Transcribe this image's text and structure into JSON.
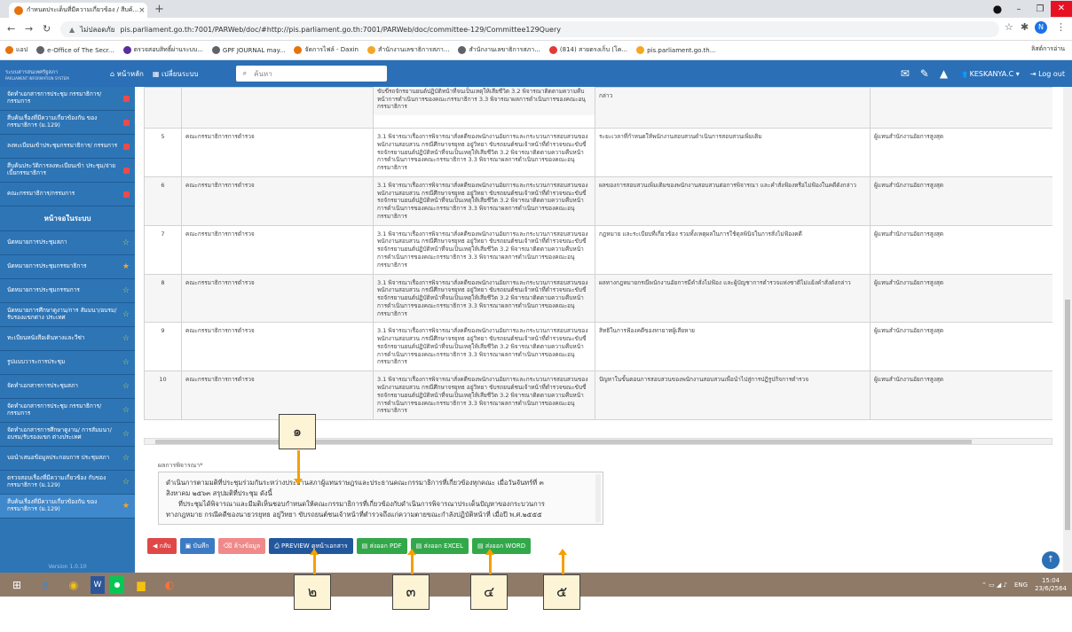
{
  "browser": {
    "tab_title": "กำหนดประเด็นที่มีความเกี่ยวข้อง / สืบค้...",
    "new_tab": "+",
    "url_warning": "ไม่ปลอดภัย",
    "url": "pis.parliament.go.th:7001/PARWeb/doc/#http://pis.parliament.go.th:7001/PARWeb/doc/committee-129/Committee129Query",
    "profile_initial": "N",
    "reading_list": "ลิสต์การอ่าน"
  },
  "bookmarks": [
    {
      "label": "แอป",
      "color": "#e8710a"
    },
    {
      "label": "e-Office of The Secr...",
      "color": "#5f6368"
    },
    {
      "label": "ตรวจสอบสิทธิ์ผ่านระบบ...",
      "color": "#5b2c9e"
    },
    {
      "label": "GPF JOURNAL may...",
      "color": "#5f6368"
    },
    {
      "label": "จัดการไฟล์ - Daxin",
      "color": "#e8710a"
    },
    {
      "label": "สำนักงานเลขาธิการสภา...",
      "color": "#f5a623"
    },
    {
      "label": "สำนักงานเลขาธิการสภา...",
      "color": "#5f6368"
    },
    {
      "label": "(814) สายตรงเก็บ (โค...",
      "color": "#e53935"
    },
    {
      "label": "pis.parliament.go.th...",
      "color": "#f5a623"
    }
  ],
  "appbar": {
    "logo_line1": "ระบบสารสนเทศรัฐสภา",
    "logo_line2": "PARLIAMENT INFORMATION SYSTEM",
    "home": "หน้าหลัก",
    "change_system": "เปลี่ยนระบบ",
    "search_placeholder": "ค้นหา",
    "user": "KESKANYA.C",
    "logout": "Log out"
  },
  "sidebar": {
    "items_top": [
      {
        "label": "จัดทำเอกสารการประชุม กรรมาธิการ/กรรมการ"
      },
      {
        "label": "สืบค้นเรื่องที่มีความเกี่ยวข้องกัน ของกรรมาธิการ (ม.129)"
      },
      {
        "label": "ลงทะเบียนเข้าประชุมกรรมาธิการ/ กรรมการ"
      },
      {
        "label": "สืบค้นประวัติการลงทะเบียนเข้า ประชุม/จ่ายเบี้ยกรรมาธิการ"
      },
      {
        "label": "คณะกรรมาธิการ/กรรมการ"
      }
    ],
    "section": "หน้าจอในระบบ",
    "items_screens": [
      {
        "label": "นัดหมายการประชุมสภา",
        "gold": false
      },
      {
        "label": "นัดหมายการประชุมกรรมาธิการ",
        "gold": true
      },
      {
        "label": "นัดหมายการประชุมกรรมการ",
        "gold": false
      },
      {
        "label": "นัดหมายการศึกษาดูงาน/การ สัมมนา/อบรม/รับรองแขกต่าง ประเทศ",
        "gold": false
      },
      {
        "label": "ทะเบียนหนังสือเดินทางและวีซ่า",
        "gold": false
      },
      {
        "label": "รูปแบบวาระการประชุม",
        "gold": false
      },
      {
        "label": "จัดทำเอกสารการประชุมสภา",
        "gold": false
      },
      {
        "label": "จัดทำเอกสารการประชุม กรรมาธิการ/กรรมการ",
        "gold": false
      },
      {
        "label": "จัดทำเอกสารการศึกษาดูงาน/ การสัมมนา/อบรม/รับรองแขก ต่างประเทศ",
        "gold": false
      },
      {
        "label": "บอนำเสนอข้อมูลประกอบการ ประชุมสภา",
        "gold": false
      },
      {
        "label": "ตรวจสอบเรื่องที่มีความเกี่ยวข้อง กับของกรรมาธิการ (ม.129)",
        "gold": false
      },
      {
        "label": "สืบค้นเรื่องที่มีความเกี่ยวข้องกัน ของกรรมาธิการ (ม.129)",
        "gold": true
      }
    ],
    "version": "Version 1.0.10"
  },
  "table": {
    "partial_top": {
      "col3": "ของพนักงานสอบสวน กรณีศึกษาจรยุทธ อยู่วิทยา ขับรถยนต์ชนเจ้าหน้าที่ตำรวจ ขณะขับขี่รถจักรยานยนต์ปฏิบัติหน้าที่จนเป็นเหตุให้เสียชีวิต 3.2 พิจารณาติดตามความคืบหน้าการดำเนินการของคณะกรรมาธิการ 3.3 พิจารณาผลการดำเนินการของคณะอนุกรรมาธิการ",
      "col4": "กล่าว"
    },
    "rows": [
      {
        "no": "5",
        "committee": "คณะกรรมาธิการการตำรวจ",
        "agenda": "3.1 พิจารณาเรื่องการพิจารณาสั่งคดีของพนักงานอัยการและกระบวนการสอบสวนของพนักงานสอบสวน กรณีศึกษาจรยุทธ อยู่วิทยา ขับรถยนต์ชนเจ้าหน้าที่ตำรวจขณะขับขี่รถจักรยานยนต์ปฏิบัติหน้าที่จนเป็นเหตุให้เสียชีวิต 3.2 พิจารณาติดตามความคืบหน้าการดำเนินการของคณะกรรมาธิการ 3.3 พิจารณาผลการดำเนินการของคณะอนุกรรมาธิการ",
        "issue": "ระยะเวลาที่กำหนดให้พนักงานสอบสวนดำเนินการสอบสวนเพิ่มเติม",
        "invitee": "ผู้แทนสำนักงานอัยการสูงสุด"
      },
      {
        "no": "6",
        "committee": "คณะกรรมาธิการการตำรวจ",
        "agenda": "3.1 พิจารณาเรื่องการพิจารณาสั่งคดีของพนักงานอัยการและกระบวนการสอบสวนของพนักงานสอบสวน กรณีศึกษาจรยุทธ อยู่วิทยา ขับรถยนต์ชนเจ้าหน้าที่ตำรวจขณะขับขี่รถจักรยานยนต์ปฏิบัติหน้าที่จนเป็นเหตุให้เสียชีวิต 3.2 พิจารณาติดตามความคืบหน้าการดำเนินการของคณะกรรมาธิการ 3.3 พิจารณาผลการดำเนินการของคณะอนุกรรมาธิการ",
        "issue": "ผลของการสอบสวนเพิ่มเติมของพนักงานสอบสวนต่อการพิจารณา และคำสั่งฟ้องหรือไม่ฟ้องในคดีดังกล่าว",
        "invitee": "ผู้แทนสำนักงานอัยการสูงสุด"
      },
      {
        "no": "7",
        "committee": "คณะกรรมาธิการการตำรวจ",
        "agenda": "3.1 พิจารณาเรื่องการพิจารณาสั่งคดีของพนักงานอัยการและกระบวนการสอบสวนของพนักงานสอบสวน กรณีศึกษาจรยุทธ อยู่วิทยา ขับรถยนต์ชนเจ้าหน้าที่ตำรวจขณะขับขี่รถจักรยานยนต์ปฏิบัติหน้าที่จนเป็นเหตุให้เสียชีวิต 3.2 พิจารณาติดตามความคืบหน้าการดำเนินการของคณะกรรมาธิการ 3.3 พิจารณาผลการดำเนินการของคณะอนุกรรมาธิการ",
        "issue": "กฎหมาย และระเบียบที่เกี่ยวข้อง รวมทั้งเหตุผลในการใช้ดุลพินิจในการสั่งไม่ฟ้องคดี",
        "invitee": "ผู้แทนสำนักงานอัยการสูงสุด"
      },
      {
        "no": "8",
        "committee": "คณะกรรมาธิการการตำรวจ",
        "agenda": "3.1 พิจารณาเรื่องการพิจารณาสั่งคดีของพนักงานอัยการและกระบวนการสอบสวนของพนักงานสอบสวน กรณีศึกษาจรยุทธ อยู่วิทยา ขับรถยนต์ชนเจ้าหน้าที่ตำรวจขณะขับขี่รถจักรยานยนต์ปฏิบัติหน้าที่จนเป็นเหตุให้เสียชีวิต 3.2 พิจารณาติดตามความคืบหน้าการดำเนินการของคณะกรรมาธิการ 3.3 พิจารณาผลการดำเนินการของคณะอนุกรรมาธิการ",
        "issue": "ผลทางกฎหมายกรณีพนักงานอัยการมีคำสั่งไม่ฟ้อง และผู้บัญชาการตำรวจแห่งชาติไม่แย้งคำสั่งดังกล่าว",
        "invitee": "ผู้แทนสำนักงานอัยการสูงสุด"
      },
      {
        "no": "9",
        "committee": "คณะกรรมาธิการการตำรวจ",
        "agenda": "3.1 พิจารณาเรื่องการพิจารณาสั่งคดีของพนักงานอัยการและกระบวนการสอบสวนของพนักงานสอบสวน กรณีศึกษาจรยุทธ อยู่วิทยา ขับรถยนต์ชนเจ้าหน้าที่ตำรวจขณะขับขี่รถจักรยานยนต์ปฏิบัติหน้าที่จนเป็นเหตุให้เสียชีวิต 3.2 พิจารณาติดตามความคืบหน้าการดำเนินการของคณะกรรมาธิการ 3.3 พิจารณาผลการดำเนินการของคณะอนุกรรมาธิการ",
        "issue": "สิทธิในการฟ้องคดีของทายาทผู้เสียหาย",
        "invitee": "ผู้แทนสำนักงานอัยการสูงสุด"
      },
      {
        "no": "10",
        "committee": "คณะกรรมาธิการการตำรวจ",
        "agenda": "3.1 พิจารณาเรื่องการพิจารณาสั่งคดีของพนักงานอัยการและกระบวนการสอบสวนของพนักงานสอบสวน กรณีศึกษาจรยุทธ อยู่วิทยา ขับรถยนต์ชนเจ้าหน้าที่ตำรวจขณะขับขี่รถจักรยานยนต์ปฏิบัติหน้าที่จนเป็นเหตุให้เสียชีวิต 3.2 พิจารณาติดตามความคืบหน้าการดำเนินการของคณะกรรมาธิการ 3.3 พิจารณาผลการดำเนินการของคณะอนุกรรมาธิการ",
        "issue": "ปัญหาในขั้นตอนการสอบสวนของพนักงานสอบสวนเพื่อนำไปสู่การปฏิรูปกิจการตำรวจ",
        "invitee": "ผู้แทนสำนักงานอัยการสูงสุด"
      }
    ]
  },
  "result": {
    "label": "ผลการพิจารณา*",
    "line1": "ดำเนินการตามมติที่ประชุมร่วมกันระหว่างประธานสภาผู้แทนราษฎรและประธานคณะกรรมาธิการที่เกี่ยวข้องทุกคณะ เมื่อวันจันทร์ที่ ๓",
    "line2": "สิงหาคม ๒๕๖๓ สรุปมติที่ประชุม ดังนี้",
    "line3": "ที่ประชุมได้พิจารณาและมีมติเห็นชอบกำหนดให้คณะกรรมาธิการที่เกี่ยวข้องกับดำเนินการพิจารณาประเด็นปัญหาของกระบวนการ",
    "line4": "ทางกฎหมาย กรณีคดีของนายวรยุทธ อยู่วิทยา ขับรถยนต์ชนเจ้าหน้าที่ตำรวจถึงแก่ความตายขณะกำลังปฏิบัติหน้าที่ เมื่อปี พ.ศ.๒๕๕๕"
  },
  "actions": {
    "back": "กลับ",
    "save": "บันทึก",
    "clear": "ล้างข้อมูล",
    "preview": "PREVIEW ดูหน้าเอกสาร",
    "pdf": "ส่งออก PDF",
    "excel": "ส่งออก EXCEL",
    "word": "ส่งออก WORD"
  },
  "callouts": {
    "c1": "๑",
    "c2": "๒",
    "c3": "๓",
    "c4": "๔",
    "c5": "๕",
    "arrow_color": "#f5a000"
  },
  "taskbar": {
    "lang": "ENG",
    "time": "15:04",
    "date": "23/6/2564"
  },
  "colors": {
    "appbar": "#2b6fb6",
    "sidebar": "#2e75b6",
    "badge": "#e84c4c",
    "star": "#b9d54d",
    "star_active": "#f5a623"
  }
}
